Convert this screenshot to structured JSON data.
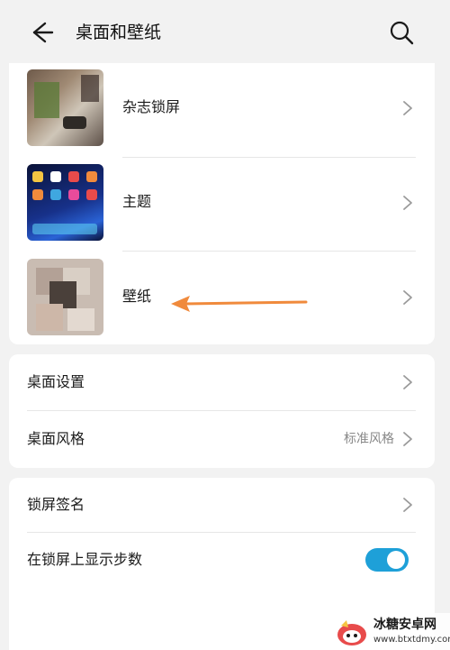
{
  "header": {
    "title": "桌面和壁纸"
  },
  "card1": {
    "items": [
      {
        "label": "杂志锁屏",
        "thumb_icon": "magazine-lockscreen-thumbnail"
      },
      {
        "label": "主题",
        "thumb_icon": "theme-thumbnail"
      },
      {
        "label": "壁纸",
        "thumb_icon": "wallpaper-thumbnail"
      }
    ]
  },
  "card2": {
    "items": [
      {
        "label": "桌面设置"
      },
      {
        "label": "桌面风格",
        "value": "标准风格"
      }
    ]
  },
  "card3": {
    "items": [
      {
        "label": "锁屏签名"
      },
      {
        "label": "在锁屏上显示步数",
        "toggle_on": true
      }
    ]
  },
  "annotation": {
    "arrow_color": "#f08a3c"
  },
  "watermark": {
    "title": "冰糖安卓网",
    "url": "www.btxtdmy.com"
  },
  "colors": {
    "accent": "#1ea0d8",
    "background": "#f2f2f2",
    "card": "#ffffff"
  }
}
